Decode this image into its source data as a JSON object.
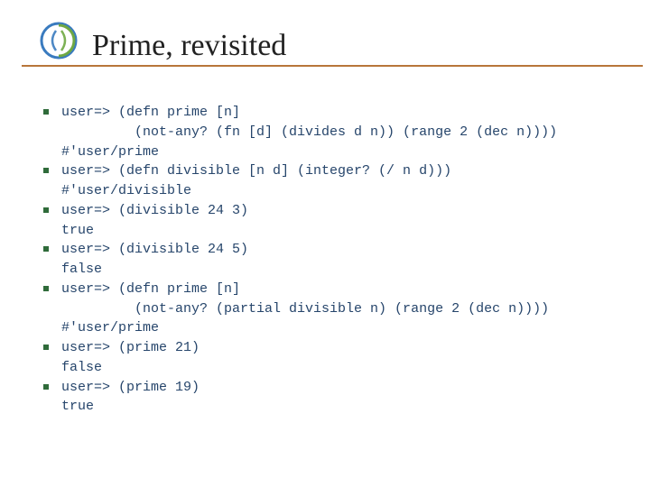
{
  "header": {
    "title": "Prime, revisited"
  },
  "code": {
    "items": [
      "user=> (defn prime [n]\n         (not-any? (fn [d] (divides d n)) (range 2 (dec n))))\n#'user/prime",
      "user=> (defn divisible [n d] (integer? (/ n d)))\n#'user/divisible",
      "user=> (divisible 24 3)\ntrue",
      "user=> (divisible 24 5)\nfalse",
      "user=> (defn prime [n]\n         (not-any? (partial divisible n) (range 2 (dec n))))\n#'user/prime",
      "user=> (prime 21)\nfalse",
      "user=> (prime 19)\ntrue"
    ]
  }
}
